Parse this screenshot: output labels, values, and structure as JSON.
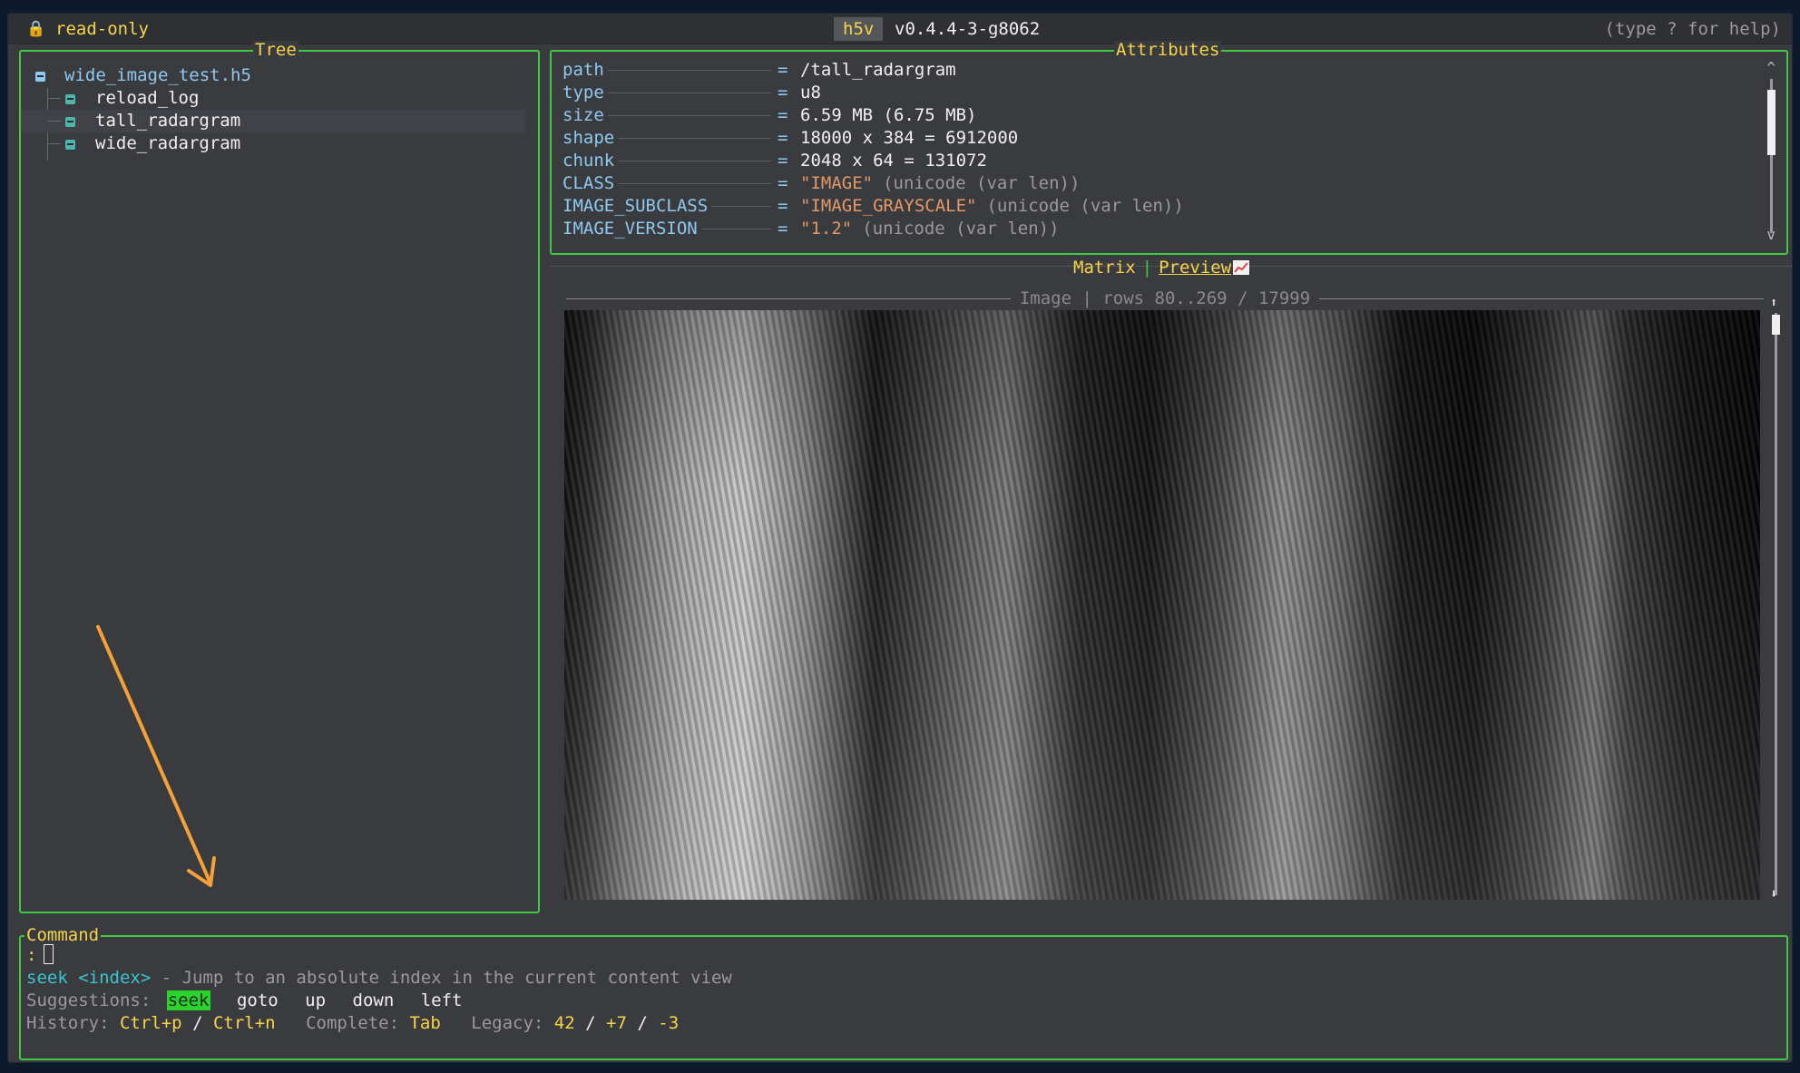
{
  "titlebar": {
    "mode": "read-only",
    "app_name": "h5v",
    "version": "v0.4.4-3-g8062",
    "help_hint": "(type ? for help)"
  },
  "tree": {
    "title": "Tree",
    "root": "wide_image_test.h5",
    "items": [
      {
        "label": "reload_log",
        "selected": false
      },
      {
        "label": "tall_radargram",
        "selected": true
      },
      {
        "label": "wide_radargram",
        "selected": false
      }
    ]
  },
  "attributes": {
    "title": "Attributes",
    "rows": [
      {
        "key": "path",
        "value": "/tall_radargram",
        "type": ""
      },
      {
        "key": "type",
        "value": "u8",
        "type": ""
      },
      {
        "key": "size",
        "value": "6.59 MB (6.75 MB)",
        "type": ""
      },
      {
        "key": "shape",
        "value": "18000 x 384 = 6912000",
        "type": ""
      },
      {
        "key": "chunk",
        "value": "2048 x 64 = 131072",
        "type": ""
      },
      {
        "key": "CLASS",
        "value": "\"IMAGE\"",
        "type": "(unicode (var len))"
      },
      {
        "key": "IMAGE_SUBCLASS",
        "value": "\"IMAGE_GRAYSCALE\"",
        "type": "(unicode (var len))"
      },
      {
        "key": "IMAGE_VERSION",
        "value": "\"1.2\"",
        "type": "(unicode (var len))"
      }
    ],
    "equals": "=",
    "scroll_up": "^",
    "scroll_down": "v"
  },
  "view": {
    "tab_matrix": "Matrix",
    "tab_separator": "|",
    "tab_preview": "Preview",
    "image_header": "Image | rows 80..269 / 17999"
  },
  "command": {
    "title": "Command",
    "prompt": ":",
    "hint_cmd": "seek <index>",
    "hint_desc": " - Jump to an absolute index in the current content view",
    "suggestions_label": "Suggestions:",
    "suggestions": [
      "seek",
      "goto",
      "up",
      "down",
      "left"
    ],
    "history_label": "History:",
    "history_prev": "Ctrl+p",
    "history_sep": "/",
    "history_next": "Ctrl+n",
    "complete_label": "Complete:",
    "complete_key": "Tab",
    "legacy_label": "Legacy:",
    "legacy_a": "42",
    "legacy_sep1": "/",
    "legacy_b": "+7",
    "legacy_sep2": "/",
    "legacy_c": "-3"
  },
  "colors": {
    "panel_border": "#3fc93f",
    "accent_yellow": "#f5d547",
    "key_blue": "#8fc9ef",
    "string_orange": "#e39868",
    "arrow_orange": "#f5a13a"
  }
}
